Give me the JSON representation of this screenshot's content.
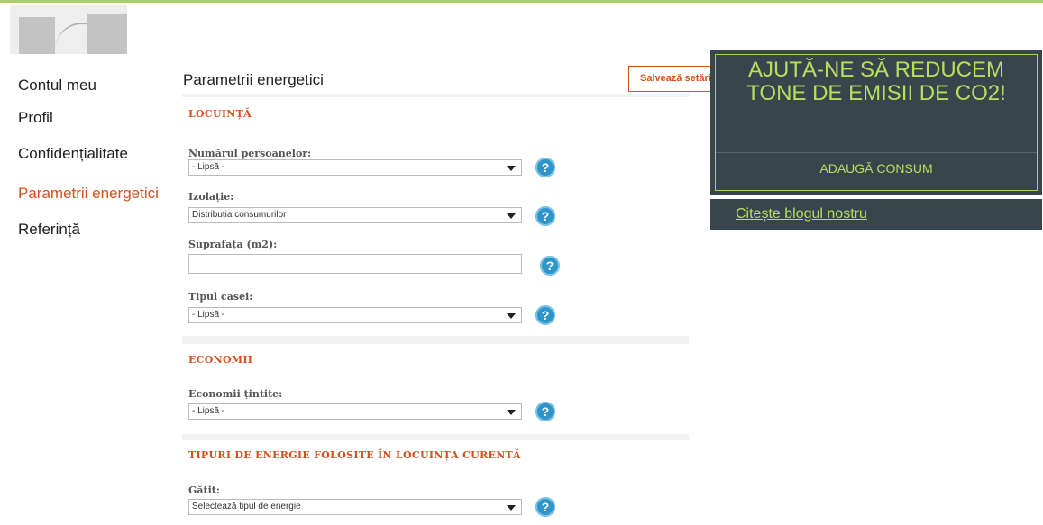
{
  "colors": {
    "accent": "#d4511e",
    "promo_bg": "#38454d",
    "promo_text": "#b6e05c",
    "help_icon": "#2f95c9"
  },
  "sidebar": {
    "items": [
      {
        "label": "Contul meu",
        "active": false
      },
      {
        "label": "Profil",
        "active": false
      },
      {
        "label": "Confidențialitate",
        "active": false
      },
      {
        "label": "Parametrii energetici",
        "active": true
      },
      {
        "label": "Referință",
        "active": false
      }
    ]
  },
  "main": {
    "title": "Parametrii energetici",
    "save_label": "Salvează setările",
    "sections": {
      "locuinta": {
        "title": "LOCUINȚĂ",
        "fields": [
          {
            "label": "Numărul persoanelor:",
            "value": "- Lipsă -"
          },
          {
            "label": "Izolație:",
            "value": "Distribuția consumurilor"
          },
          {
            "label": "Suprafața (m2):",
            "value": ""
          },
          {
            "label": "Tipul casei:",
            "value": "- Lipsă -"
          }
        ]
      },
      "economii": {
        "title": "ECONOMII",
        "fields": [
          {
            "label": "Economii țintite:",
            "value": "- Lipsă -"
          }
        ]
      },
      "energie": {
        "title": "TIPURI DE ENERGIE FOLOSITE ÎN LOCUINȚA CURENTĂ",
        "fields": [
          {
            "label": "Gătit:",
            "value": "Selectează tipul de energie"
          }
        ]
      }
    }
  },
  "promo": {
    "title": "AJUTĂ-NE SĂ REDUCEM TONE DE EMISII DE CO2!",
    "button": "ADAUGĂ CONSUM",
    "blog_link": "Citește blogul nostru"
  },
  "icons": {
    "help": "help-icon",
    "dropdown": "chevron-down-icon",
    "avatar": "avatar-placeholder"
  },
  "help_glyph": "?"
}
